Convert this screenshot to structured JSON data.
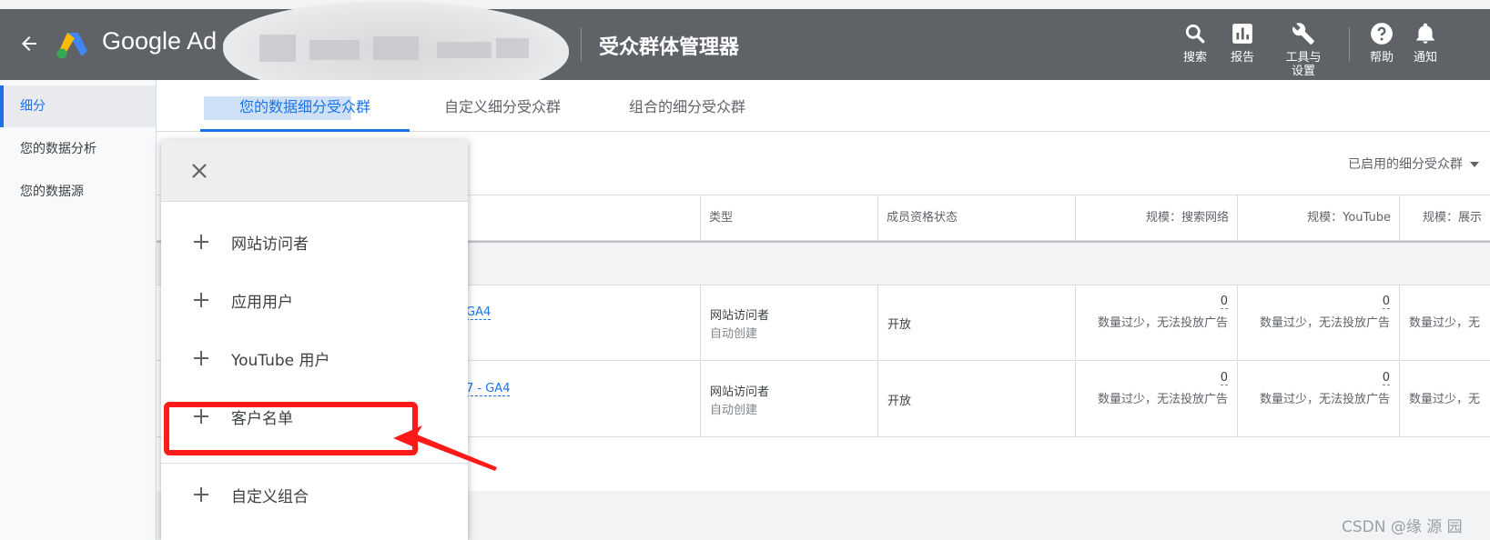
{
  "header": {
    "brand": "Google Ad",
    "title": "受众群体管理器",
    "buttons": {
      "search": "搜索",
      "reports": "报告",
      "tools_line1": "工具与",
      "tools_line2": "设置",
      "help": "帮助",
      "notifications": "通知"
    }
  },
  "sidebar": {
    "items": [
      {
        "label": "细分"
      },
      {
        "label": "您的数据分析"
      },
      {
        "label": "您的数据源"
      }
    ]
  },
  "tabs": [
    {
      "label": "您的数据细分受众群"
    },
    {
      "label": "自定义细分受众群"
    },
    {
      "label": "组合的细分受众群"
    }
  ],
  "filter": {
    "label": "已启用的细分受众群"
  },
  "table": {
    "headers": [
      "类型",
      "成员资格状态",
      "规模：搜索网络",
      "规模：YouTube",
      "规模：展示"
    ],
    "rows": [
      {
        "name_partial": "GA4",
        "type": "网站访问者",
        "type_sub": "自动创建",
        "status": "开放",
        "search_size": "0",
        "youtube_size": "0",
        "msg": "数量过少，无法投放广告",
        "msg_partial": "数量过少，无"
      },
      {
        "name_partial": "7 - GA4",
        "type": "网站访问者",
        "type_sub": "自动创建",
        "status": "开放",
        "search_size": "0",
        "youtube_size": "0",
        "msg": "数量过少，无法投放广告",
        "msg_partial": "数量过少，无"
      }
    ]
  },
  "menu": {
    "items": [
      {
        "label": "网站访问者"
      },
      {
        "label": "应用用户"
      },
      {
        "label": "YouTube 用户"
      },
      {
        "label": "客户名单"
      },
      {
        "label": "自定义组合"
      }
    ]
  },
  "watermark": "CSDN @缘 源 园",
  "colors": {
    "header_bg": "#5f6368",
    "accent": "#1a73e8",
    "annotation": "#ff1a1a"
  }
}
